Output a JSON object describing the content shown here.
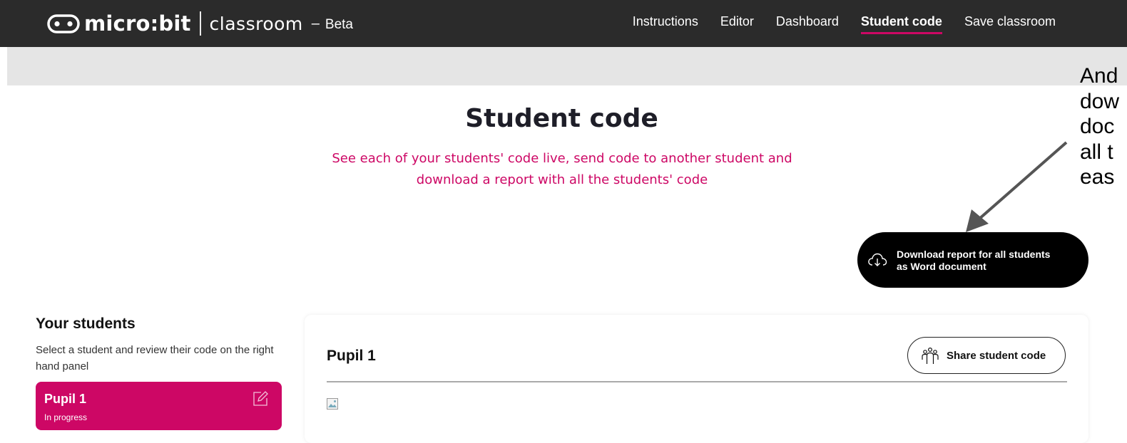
{
  "header": {
    "brand": "micro:bit",
    "product": "classroom",
    "dash": "–",
    "tag": "Beta",
    "nav": [
      {
        "label": "Instructions",
        "active": false
      },
      {
        "label": "Editor",
        "active": false
      },
      {
        "label": "Dashboard",
        "active": false
      },
      {
        "label": "Student code",
        "active": true
      },
      {
        "label": "Save classroom",
        "active": false
      }
    ]
  },
  "page": {
    "title": "Student code",
    "subtitle_line1": "See each of your students' code live, send code to another student and",
    "subtitle_line2": "download a report with all the students' code"
  },
  "annotation": {
    "lines": [
      "And",
      "dow",
      "doc",
      "all t",
      "eas"
    ]
  },
  "download": {
    "label_line1": "Download report for all students",
    "label_line2": "as Word document",
    "icon": "cloud-download-icon"
  },
  "students_panel": {
    "title": "Your students",
    "description": "Select a student and review their code on the right hand panel",
    "students": [
      {
        "name": "Pupil 1",
        "status": "In progress",
        "icon": "edit-icon"
      }
    ]
  },
  "code_panel": {
    "title": "Pupil 1",
    "share_label": "Share student code",
    "share_icon": "group-share-icon"
  },
  "colors": {
    "topbar": "#2b2b2b",
    "accent": "#cd0765",
    "greyband": "#e5e5e5",
    "button_dark": "#000000"
  }
}
